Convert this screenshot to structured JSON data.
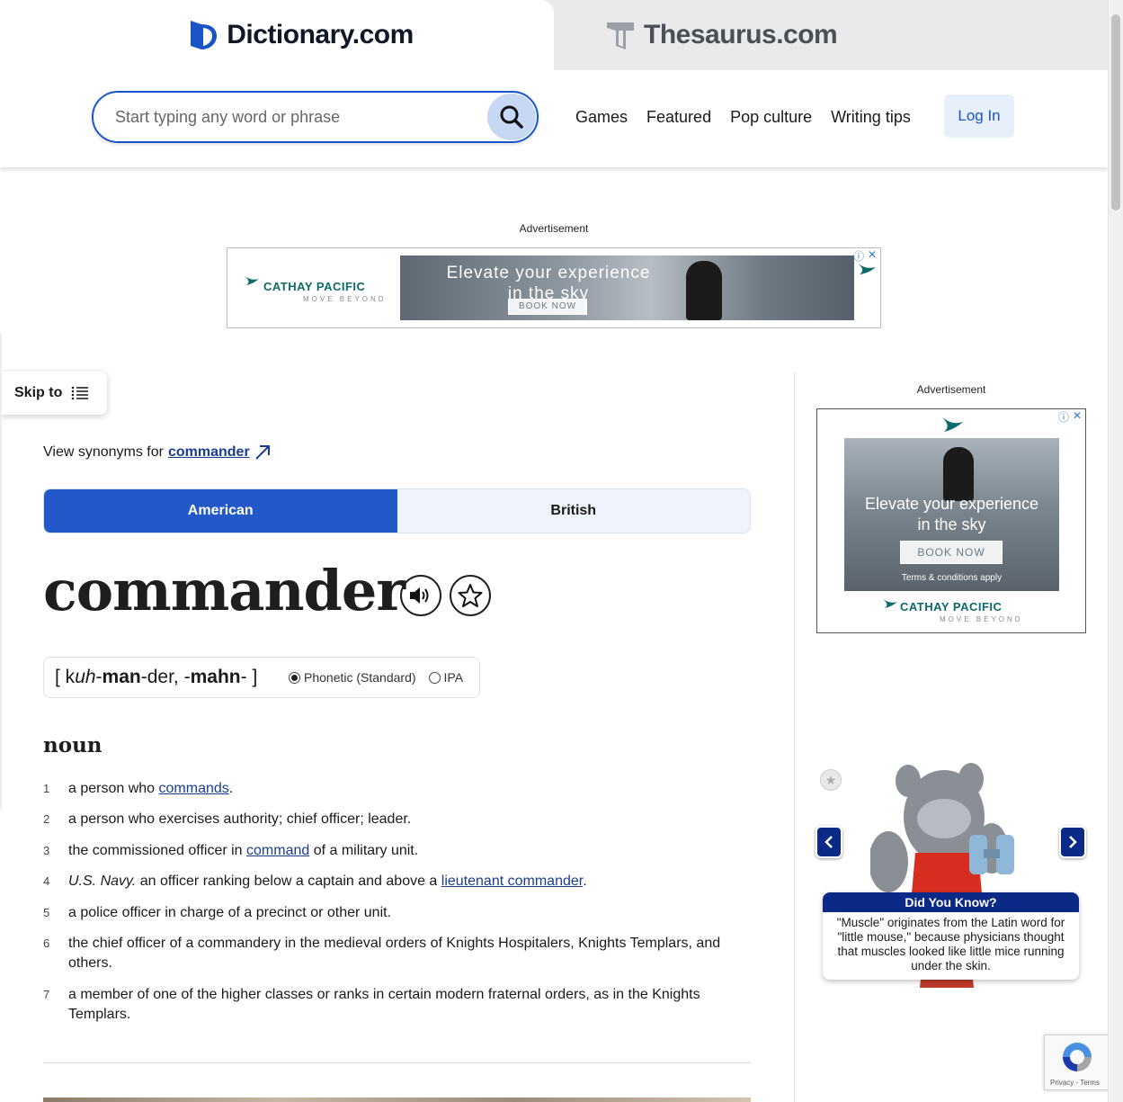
{
  "tabs": {
    "dictionary": "Dictionary.com",
    "thesaurus": "Thesaurus.com"
  },
  "search": {
    "placeholder": "Start typing any word or phrase"
  },
  "nav": [
    "Games",
    "Featured",
    "Pop culture",
    "Writing tips"
  ],
  "login_label": "Log In",
  "ads": {
    "label": "Advertisement",
    "top_headline_1": "Elevate your experience",
    "top_headline_2": "in the sky",
    "cta": "BOOK NOW",
    "brand": "CATHAY PACIFIC",
    "brand_tagline": "MOVE BEYOND",
    "terms": "Terms & conditions apply"
  },
  "skip_label": "Skip to",
  "synonyms": {
    "prefix": "View synonyms for",
    "word": "commander"
  },
  "toggle": {
    "american": "American",
    "british": "British"
  },
  "headword": "commander",
  "pronunciation": {
    "open": "[",
    "part1": " k",
    "part2": "uh",
    "part3": "-",
    "part4": "man",
    "part5": "-der, -",
    "part6": "mahn",
    "part7": "- ",
    "close": "]",
    "option_phonetic": "Phonetic (Standard)",
    "option_ipa": "IPA"
  },
  "part_of_speech": "noun",
  "definitions": [
    {
      "num": "1",
      "pre": "a person who ",
      "link": "commands",
      "post": "."
    },
    {
      "num": "2",
      "text": "a person who exercises authority; chief officer; leader."
    },
    {
      "num": "3",
      "pre": "the commissioned officer in ",
      "link": "command",
      "post": " of a military unit."
    },
    {
      "num": "4",
      "label": "U.S. Navy.",
      "pre": " an officer ranking below a captain and above a ",
      "link": "lieutenant commander",
      "post": "."
    },
    {
      "num": "5",
      "text": "a police officer in charge of a precinct or other unit."
    },
    {
      "num": "6",
      "text": "the chief officer of a commandery in the medieval orders of Knights Hospitalers, Knights Templars, and others."
    },
    {
      "num": "7",
      "text": "a member of one of the higher classes or ranks in certain modern fraternal orders, as in the Knights Templars."
    }
  ],
  "did_you_know": {
    "title": "Did You Know?",
    "body": "\"Muscle\" originates from the Latin word for \"little mouse,\" because physicians thought that muscles looked like little mice running under the skin."
  },
  "recaptcha": {
    "terms": "Privacy - Terms"
  }
}
